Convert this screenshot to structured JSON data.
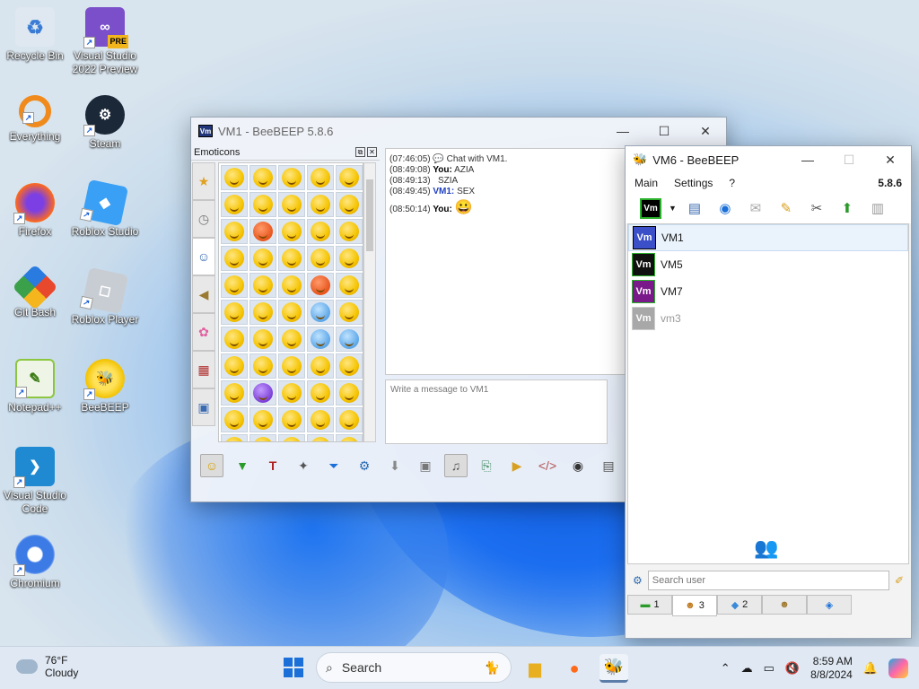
{
  "desktop_icons": [
    {
      "label": "Recycle Bin",
      "icon": "recycle-bin-icon",
      "color": "#dfe8f0"
    },
    {
      "label": "Visual Studio 2022 Preview",
      "icon": "visual-studio-preview-icon",
      "badge": "PRE",
      "color": "#7b4fc9"
    },
    {
      "label": "Everything",
      "icon": "magnifier-icon",
      "color": "#f08a1c"
    },
    {
      "label": "Steam",
      "icon": "steam-icon",
      "color": "#1b2838"
    },
    {
      "label": "Firefox",
      "icon": "firefox-icon",
      "color": "#ff6a1a"
    },
    {
      "label": "Roblox Studio",
      "icon": "roblox-studio-icon",
      "color": "#3aa0f5"
    },
    {
      "label": "Git Bash",
      "icon": "git-bash-icon",
      "color": "#e8482c"
    },
    {
      "label": "Roblox Player",
      "icon": "roblox-player-icon",
      "color": "#c8cdd3"
    },
    {
      "label": "Notepad++",
      "icon": "notepad-plus-plus-icon",
      "color": "#8cc63f"
    },
    {
      "label": "BeeBEEP",
      "icon": "bee-icon",
      "color": "#f2c200"
    },
    {
      "label": "Visual Studio Code",
      "icon": "vscode-icon",
      "color": "#1f8ad2"
    },
    {
      "label": "Chromium",
      "icon": "chromium-icon",
      "color": "#3c7be6"
    }
  ],
  "vm1_window": {
    "title": "VM1 - BeeBEEP 5.8.6",
    "emoticons_label": "Emoticons",
    "chat": [
      {
        "time": "(07:46:05)",
        "text": "Chat with VM1."
      },
      {
        "time": "(08:49:08)",
        "sender": "You:",
        "text": "AZIA"
      },
      {
        "time": "(08:49:13)",
        "sender": "",
        "text": "SZIA"
      },
      {
        "time": "(08:49:45)",
        "sender": "VM1:",
        "text": "SEX",
        "remote": true
      },
      {
        "time": "(08:50:14)",
        "sender": "You:",
        "text": "😀"
      }
    ],
    "input_placeholder": "Write a message to VM1"
  },
  "vm6_window": {
    "title": "VM6 - BeeBEEP",
    "menu": [
      "Main",
      "Settings",
      "?"
    ],
    "version": "5.8.6",
    "users": [
      {
        "name": "VM1",
        "avatar": "Vm",
        "color": "#3a4fc8",
        "selected": true,
        "online": true
      },
      {
        "name": "VM5",
        "avatar": "Vm",
        "color": "#101010",
        "selected": false,
        "online": true
      },
      {
        "name": "VM7",
        "avatar": "Vm",
        "color": "#7a1a8a",
        "selected": false,
        "online": true
      },
      {
        "name": "vm3",
        "avatar": "Vm",
        "color": "#a8a8a8",
        "selected": false,
        "online": false
      }
    ],
    "search_placeholder": "Search user",
    "tabs": [
      {
        "count": "1",
        "icon": "chat-icon"
      },
      {
        "count": "3",
        "icon": "users-icon"
      },
      {
        "count": "2",
        "icon": "groups-icon"
      },
      {
        "count": "",
        "icon": "group-users-icon"
      },
      {
        "count": "",
        "icon": "network-icon"
      }
    ]
  },
  "taskbar": {
    "temperature": "76°F",
    "condition": "Cloudy",
    "search_label": "Search",
    "time": "8:59 AM",
    "date": "8/8/2024"
  }
}
